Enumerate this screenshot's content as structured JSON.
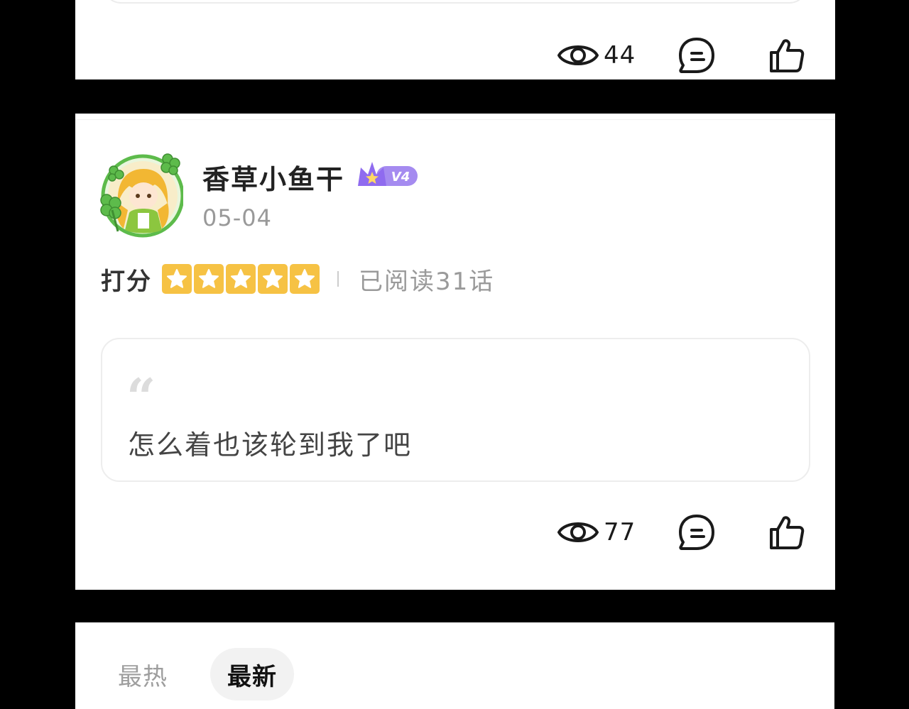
{
  "post_top": {
    "views": "44"
  },
  "post_main": {
    "username": "香草小鱼干",
    "level": "V4",
    "date": "05-04",
    "rating_label": "打分",
    "stars": 5,
    "stars_max": 5,
    "read_progress": "已阅读31话",
    "quote_mark": "“",
    "content": "怎么着也该轮到我了吧",
    "views": "77"
  },
  "sort_tabs": {
    "hot": "最热",
    "new": "最新",
    "active": "new"
  },
  "colors": {
    "star_bg": "#f6c244",
    "badge_purple": "#a58bf0",
    "avatar_ring": "#5dbb4b"
  },
  "icons": {
    "views": "eye-icon",
    "comment": "comment-bubble-icon",
    "like": "thumbs-up-icon",
    "rating": "star-icon",
    "level": "crown-icon"
  }
}
